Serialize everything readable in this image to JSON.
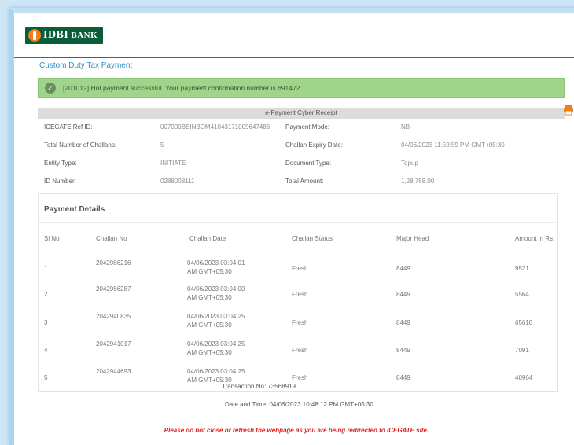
{
  "bank": {
    "logo_name": "IDBI",
    "logo_suffix": "BANK"
  },
  "page_title": "Custom Duty Tax Payment",
  "alert": {
    "message": "[201012] Hot payment successful. Your payment confirmation number is 691472."
  },
  "receipt": {
    "title": "e-Payment Cyber Receipt"
  },
  "info": {
    "icegate_ref_label": "ICEGATE Ref ID:",
    "icegate_ref_value": "007000BEINBOM41043171009647486",
    "payment_mode_label": "Payment Mode:",
    "payment_mode_value": "NB",
    "num_challans_label": "Total Number of Challans:",
    "num_challans_value": "5",
    "challan_expiry_label": "Challan Expiry Date:",
    "challan_expiry_value": "04/06/2023 11:59:59 PM GMT+05:30",
    "entity_type_label": "Entity Type:",
    "entity_type_value": "INITIATE",
    "document_type_label": "Document Type:",
    "document_type_value": "Topup",
    "id_number_label": "ID Number:",
    "id_number_value": "0288008111",
    "total_amount_label": "Total Amount:",
    "total_amount_value": "1,28,758.00"
  },
  "payment_details": {
    "title": "Payment Details",
    "columns": [
      "Sl No",
      "Challan No",
      "Challan Date",
      "Challan Status",
      "Major Head",
      "Amount in Rs."
    ],
    "rows": [
      {
        "sl": "1",
        "challan_no": "2042986216",
        "date_line1": "04/06/2023 03:04:01",
        "date_line2": "AM GMT+05:30",
        "status": "Fresh",
        "major_head": "8449",
        "amount": "9521"
      },
      {
        "sl": "2",
        "challan_no": "2042986287",
        "date_line1": "04/06/2023 03:04:00",
        "date_line2": "AM GMT+05:30",
        "status": "Fresh",
        "major_head": "8449",
        "amount": "5564"
      },
      {
        "sl": "3",
        "challan_no": "2042940835",
        "date_line1": "04/06/2023 03:04:25",
        "date_line2": "AM GMT+05:30",
        "status": "Fresh",
        "major_head": "8449",
        "amount": "65618"
      },
      {
        "sl": "4",
        "challan_no": "2042941017",
        "date_line1": "04/06/2023 03:04:25",
        "date_line2": "AM GMT+05:30",
        "status": "Fresh",
        "major_head": "8449",
        "amount": "7091"
      },
      {
        "sl": "5",
        "challan_no": "2042944693",
        "date_line1": "04/06/2023 03:04:25",
        "date_line2": "AM GMT+05:30",
        "status": "Fresh",
        "major_head": "8449",
        "amount": "40964"
      }
    ]
  },
  "transaction": {
    "no_label": "Transaction No:",
    "no_value": "73568919",
    "datetime_label": "Date and Time:",
    "datetime_value": "04/06/2023 10:48:12 PM GMT+05:30"
  },
  "warning": "Please do not close or refresh the webpage as you are being redirected to ICEGATE site.",
  "colors": {
    "brand_green": "#0b5d3a",
    "brand_orange": "#f07d1e",
    "success_bg": "#9fd48a",
    "link_blue": "#2a93c6",
    "warning_red": "#e21d1d"
  },
  "icons": {
    "logo": "idbi-logo-icon",
    "success": "check-circle-icon",
    "print": "printer-icon"
  }
}
